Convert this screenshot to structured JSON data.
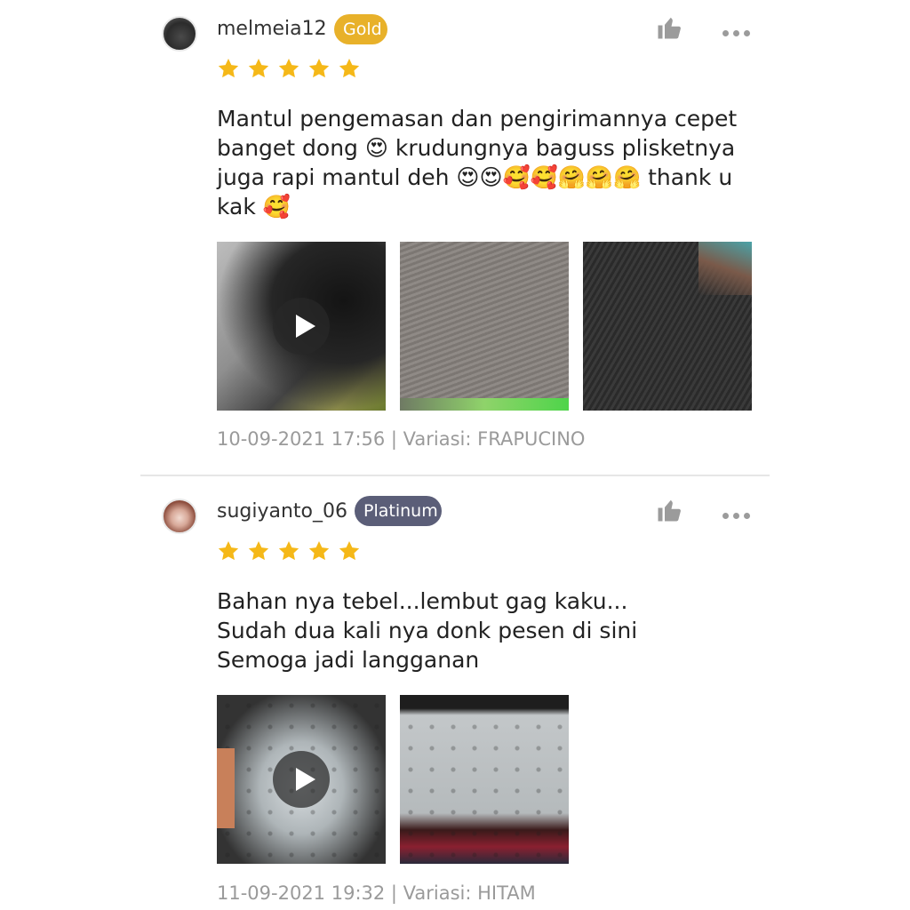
{
  "reviews": [
    {
      "username": "melmeia12",
      "badge": "Gold",
      "rating": 5,
      "comment": "Mantul pengemasan dan pengirimannya cepet\nbanget dong 😍 krudungnya baguss plisketnya\njuga rapi mantul deh 😍😍🥰🥰🤗🤗🤗 thank u\nkak 🥰",
      "media": [
        {
          "type": "video",
          "icon": "play-icon"
        },
        {
          "type": "photo"
        },
        {
          "type": "photo"
        }
      ],
      "meta": "10-09-2021 17:56 | Variasi: FRAPUCINO"
    },
    {
      "username": "sugiyanto_06",
      "badge": "Platinum",
      "rating": 5,
      "comment": "Bahan nya tebel...lembut gag kaku...\nSudah dua kali nya donk pesen di sini\nSemoga jadi langganan",
      "media": [
        {
          "type": "video",
          "icon": "play-icon"
        },
        {
          "type": "photo"
        }
      ],
      "meta": "11-09-2021 19:32 | Variasi: HITAM"
    }
  ],
  "colors": {
    "star": "#f5b818",
    "gold_badge": "#e8b12a",
    "platinum_badge": "#5b5e78",
    "meta_text": "#9a9a9a"
  },
  "icons": [
    "thumbs-up-icon",
    "more-options-icon",
    "star-icon",
    "play-icon"
  ]
}
